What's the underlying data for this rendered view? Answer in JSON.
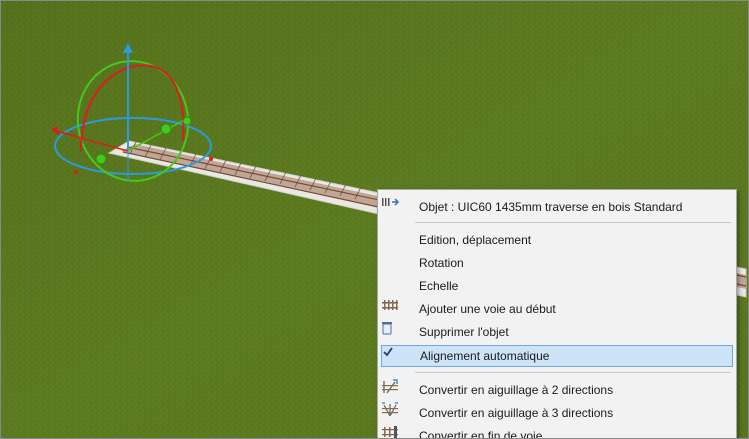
{
  "scene": {
    "ground_color": "#5c7a1f",
    "track_color": "#e8e8e4",
    "rail_color": "#8c4b32",
    "gizmo_colors": {
      "x": "#d81e1e",
      "y": "#2a9be0",
      "z": "#46c81e"
    }
  },
  "context_menu": {
    "header": {
      "label": "Objet : UIC60 1435mm traverse en bois Standard",
      "icon": "track-object-icon"
    },
    "items": [
      {
        "label": "Edition, déplacement",
        "icon": ""
      },
      {
        "label": "Rotation",
        "icon": ""
      },
      {
        "label": "Echelle",
        "icon": ""
      },
      {
        "label": "Ajouter une voie au début",
        "icon": "add-track-icon"
      },
      {
        "label": "Supprimer l'objet",
        "icon": "trash-icon"
      },
      {
        "label": "Alignement automatique",
        "icon": "checkmark-icon",
        "checked": true
      }
    ],
    "convert_items": [
      {
        "label": "Convertir en aiguillage à 2 directions",
        "icon": "switch-2-icon"
      },
      {
        "label": "Convertir en aiguillage à 3 directions",
        "icon": "switch-3-icon"
      },
      {
        "label": "Convertir en fin de voie",
        "icon": "track-end-icon"
      }
    ],
    "highlight_color": "#cde3f7"
  }
}
